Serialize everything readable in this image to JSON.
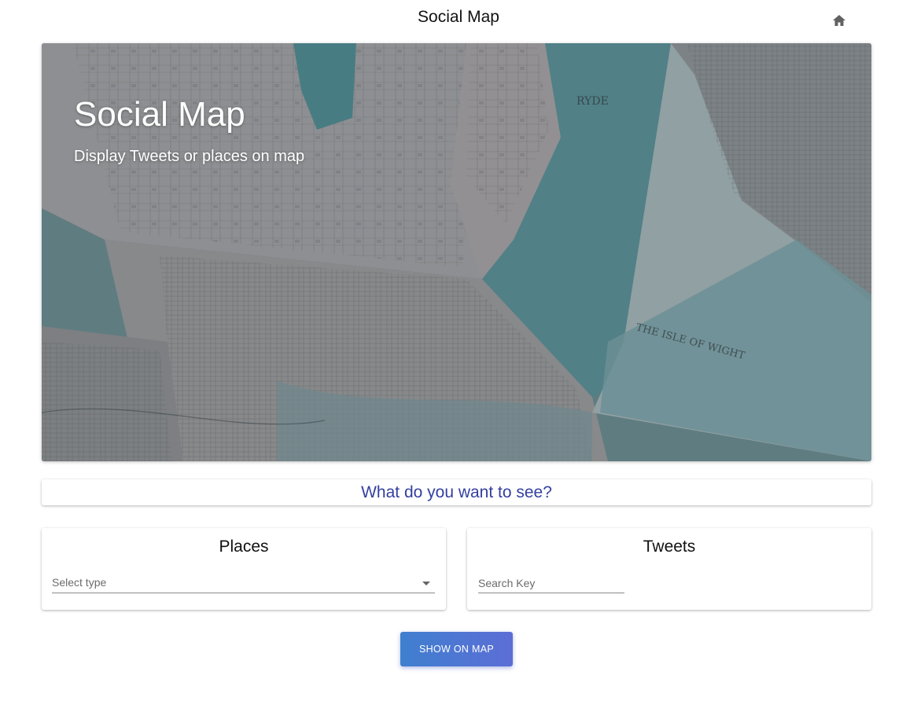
{
  "header": {
    "title": "Social Map",
    "home_icon": "home-icon"
  },
  "hero": {
    "title": "Social Map",
    "subtitle": "Display Tweets or places on map"
  },
  "question": "What do you want to see?",
  "places": {
    "title": "Places",
    "select_placeholder": "Select type"
  },
  "tweets": {
    "title": "Tweets",
    "search_placeholder": "Search Key"
  },
  "action": {
    "show_label": "SHOW ON MAP"
  },
  "colors": {
    "accent": "#3340a0",
    "button_start": "#3f7fcf",
    "button_end": "#5c6ed6"
  }
}
